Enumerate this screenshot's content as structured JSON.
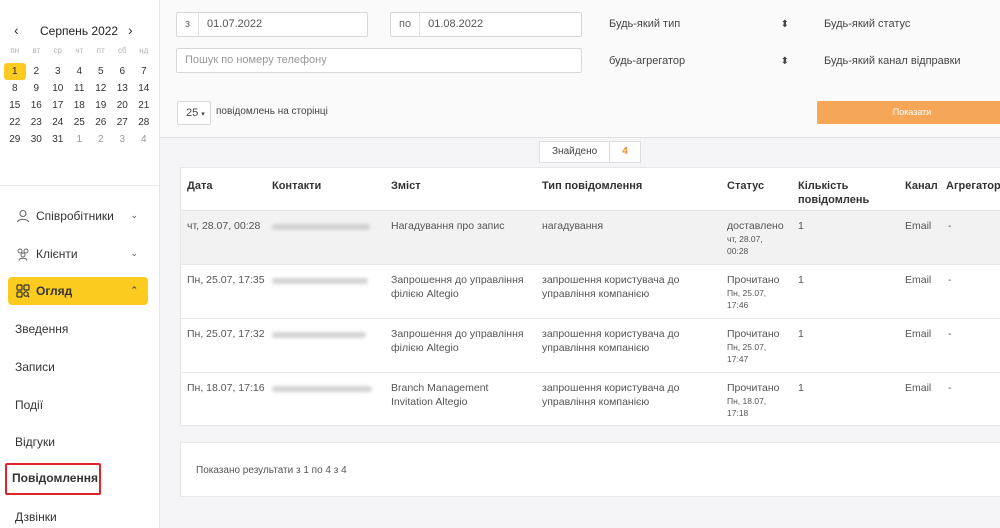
{
  "calendar": {
    "title": "Серпень 2022",
    "prev": "‹",
    "next": "›",
    "dow": [
      "пн",
      "вт",
      "ср",
      "чт",
      "пт",
      "сб",
      "нд"
    ],
    "weeks": [
      [
        "1",
        "2",
        "3",
        "4",
        "5",
        "6",
        "7"
      ],
      [
        "8",
        "9",
        "10",
        "11",
        "12",
        "13",
        "14"
      ],
      [
        "15",
        "16",
        "17",
        "18",
        "19",
        "20",
        "21"
      ],
      [
        "22",
        "23",
        "24",
        "25",
        "26",
        "27",
        "28"
      ],
      [
        "29",
        "30",
        "31",
        "1",
        "2",
        "3",
        "4"
      ]
    ],
    "selected": "1"
  },
  "nav": {
    "staff": "Співробітники",
    "clients": "Клієнти",
    "overview": "Огляд",
    "sub": [
      "Зведення",
      "Записи",
      "Події",
      "Відгуки",
      "Повідомлення",
      "Дзвінки"
    ]
  },
  "filters": {
    "from_prefix": "з",
    "from_value": "01.07.2022",
    "to_prefix": "по",
    "to_value": "01.08.2022",
    "type": "Будь-який тип",
    "status": "Будь-який статус",
    "phone_placeholder": "Пошук по номеру телефону",
    "aggregator": "будь-агрегатор",
    "channel": "Будь-який канал відправки",
    "per_page": "25",
    "per_page_label": "повідомлень на сторінці",
    "show_button": "Показати"
  },
  "found": {
    "label": "Знайдено",
    "count": "4"
  },
  "table": {
    "headers": [
      "Дата",
      "Контакти",
      "Зміст",
      "Тип повідомлення",
      "Статус",
      "Кількість повідомлень",
      "Канал",
      "Агрегатор"
    ],
    "rows": [
      {
        "date": "чт, 28.07, 00:28",
        "content": "Нагадування про запис",
        "type": "нагадування",
        "status": "доставлено",
        "status_time": "чт, 28.07, 00:28",
        "count": "1",
        "channel": "Email",
        "aggregator": "-"
      },
      {
        "date": "Пн, 25.07, 17:35",
        "content": "Запрошення до управління філією Altegio",
        "type": "запрошення користувача до управління компанією",
        "status": "Прочитано",
        "status_time": "Пн, 25.07, 17:46",
        "count": "1",
        "channel": "Email",
        "aggregator": "-"
      },
      {
        "date": "Пн, 25.07, 17:32",
        "content": "Запрошення до управління філією Altegio",
        "type": "запрошення користувача до управління компанією",
        "status": "Прочитано",
        "status_time": "Пн, 25.07, 17:47",
        "count": "1",
        "channel": "Email",
        "aggregator": "-"
      },
      {
        "date": "Пн, 18.07, 17:16",
        "content": "Branch Management Invitation Altegio",
        "type": "запрошення користувача до управління компанією",
        "status": "Прочитано",
        "status_time": "Пн, 18.07, 17:18",
        "count": "1",
        "channel": "Email",
        "aggregator": "-"
      }
    ]
  },
  "footer": {
    "text": "Показано результати з 1 по 4 з 4"
  }
}
